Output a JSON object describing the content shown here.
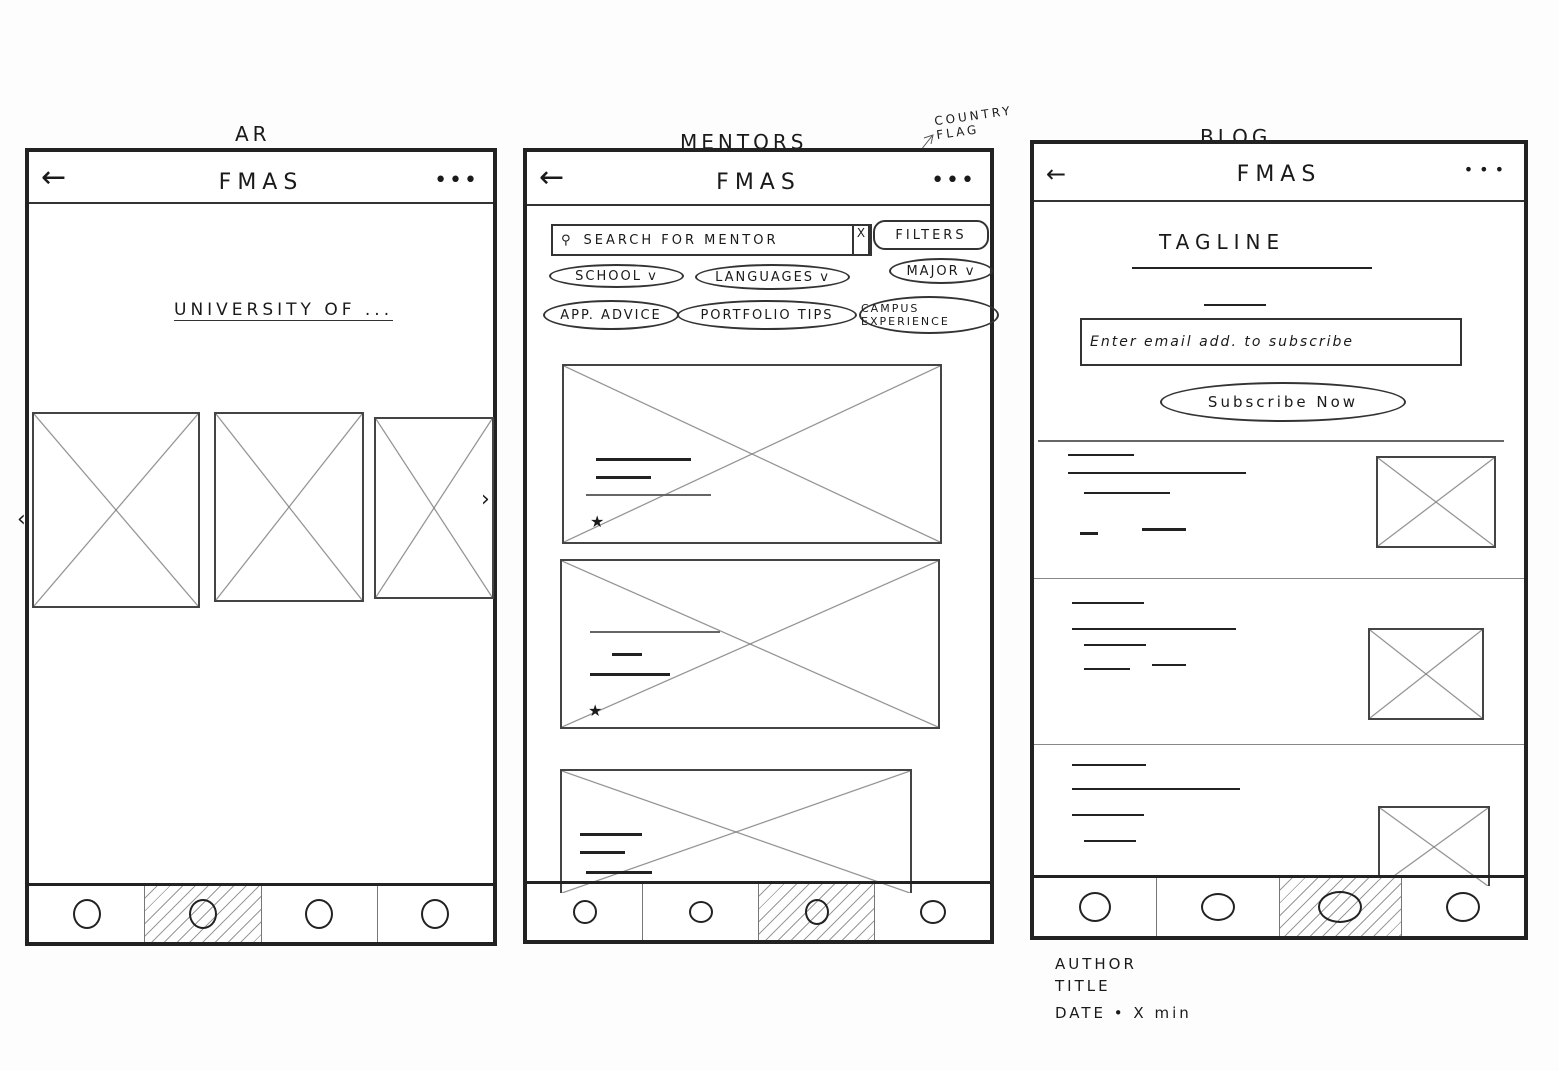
{
  "screens": [
    {
      "label": "AR",
      "app_title": "FMAS",
      "back_icon": "←",
      "more_icon": "•••",
      "heading": "UNIVERSITY OF ..."
    },
    {
      "label": "MENTORS",
      "app_title": "FMAS",
      "back_icon": "←",
      "more_icon": "•••",
      "search_placeholder": "SEARCH FOR MENTOR",
      "filters_label": "FILTERS",
      "chips": [
        "SCHOOL v",
        "LANGUAGES v",
        "MAJOR v",
        "APP. ADVICE",
        "PORTFOLIO TIPS",
        "CAMPUS EXPERIENCE"
      ],
      "annotation": "COUNTRY FLAG"
    },
    {
      "label": "BLOG",
      "app_title": "FMAS",
      "back_icon": "←",
      "more_icon": "•••",
      "tagline": "TAGLINE",
      "email_placeholder": "Enter email add. to subscribe",
      "subscribe_label": "Subscribe Now",
      "notes": [
        "AUTHOR",
        "TITLE",
        "DATE • X min"
      ]
    }
  ],
  "active_tabs": [
    2,
    3,
    3
  ]
}
